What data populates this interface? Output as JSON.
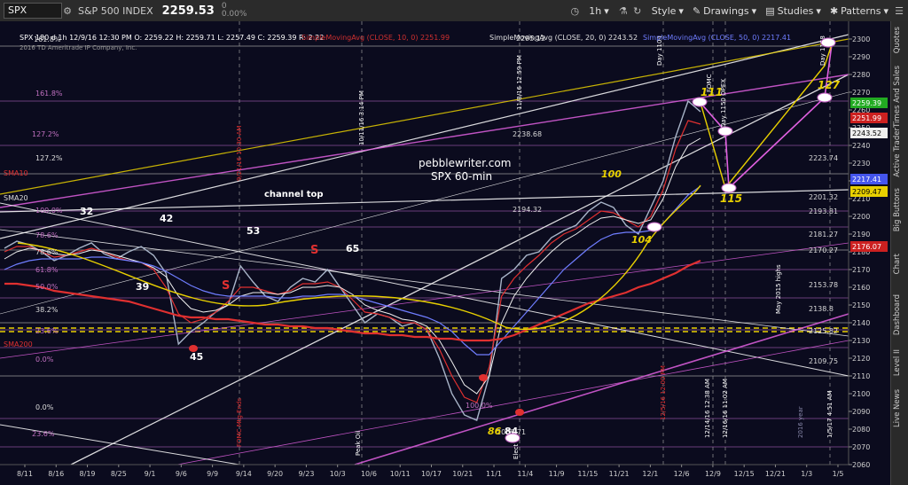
{
  "toolbar": {
    "symbol": "SPX",
    "name": "S&P 500 INDEX",
    "price": "2259.53",
    "change": "0",
    "change_pct": "0.00%",
    "interval": "1h",
    "style_label": "Style",
    "drawings_label": "Drawings",
    "studies_label": "Studies",
    "patterns_label": "Patterns"
  },
  "legend": {
    "ohlc": "SPX 180 d 1h   12/9/16 12:30 PM  O: 2259.22  H: 2259.71  L: 2257.49  C: 2259.39  R: 2.22",
    "sma10": "SimpleMovingAvg (CLOSE, 10, 0)  2251.99",
    "sma20": "SimpleMovingAvg (CLOSE, 20, 0)  2243.52",
    "sma50": "SimpleMovingAvg (CLOSE, 50, 0)  2217.41",
    "copyright": "2016 TD Ameritrade IP Company, Inc."
  },
  "right_tabs": [
    "Quotes",
    "Times And Sales",
    "Active Trader",
    "Big Buttons",
    "Chart",
    "Dashboard",
    "Level II",
    "Live News"
  ],
  "colors": {
    "background": "#0b0b1e",
    "sma10": "#e03030",
    "sma20": "#eeeeee",
    "sma50": "#6f7dff",
    "sma200": "#e03030",
    "gold": "#e8d000",
    "fib": "#c060c0",
    "channel": "#e060e0"
  },
  "chart_data": {
    "type": "line",
    "title": "pebblewriter.com SPX 60-min",
    "ylim": [
      2060,
      2305
    ],
    "y_ticks": [
      2060,
      2070,
      2080,
      2090,
      2100,
      2110,
      2120,
      2130,
      2140,
      2150,
      2160,
      2170,
      2180,
      2190,
      2200,
      2210,
      2220,
      2230,
      2240,
      2250,
      2260,
      2270,
      2280,
      2290,
      2300
    ],
    "x_labels": [
      "8/11",
      "8/16",
      "8/19",
      "8/25",
      "9/1",
      "9/6",
      "9/9",
      "9/14",
      "9/20",
      "9/23",
      "10/3",
      "10/6",
      "10/11",
      "10/17",
      "10/21",
      "11/1",
      "11/4",
      "11/9",
      "11/15",
      "11/21",
      "12/1",
      "12/6",
      "12/9",
      "12/15",
      "12/21",
      "1/3",
      "1/5"
    ],
    "series": [
      {
        "name": "SPX",
        "values": [
          2182,
          2186,
          2184,
          2180,
          2175,
          2178,
          2182,
          2185,
          2179,
          2176,
          2180,
          2183,
          2178,
          2168,
          2128,
          2135,
          2140,
          2146,
          2150,
          2172,
          2163,
          2155,
          2152,
          2160,
          2165,
          2163,
          2170,
          2160,
          2150,
          2140,
          2145,
          2143,
          2138,
          2140,
          2136,
          2120,
          2100,
          2088,
          2085,
          2110,
          2165,
          2170,
          2178,
          2180,
          2188,
          2192,
          2195,
          2203,
          2208,
          2205,
          2195,
          2190,
          2205,
          2220,
          2245,
          2265,
          2259
        ]
      },
      {
        "name": "SMA10",
        "values": [
          2180,
          2183,
          2183,
          2180,
          2177,
          2178,
          2180,
          2182,
          2180,
          2177,
          2175,
          2174,
          2170,
          2160,
          2145,
          2140,
          2142,
          2146,
          2152,
          2160,
          2160,
          2158,
          2156,
          2158,
          2162,
          2162,
          2163,
          2160,
          2153,
          2146,
          2145,
          2143,
          2140,
          2140,
          2136,
          2125,
          2110,
          2098,
          2095,
          2115,
          2155,
          2165,
          2172,
          2178,
          2185,
          2190,
          2193,
          2198,
          2203,
          2202,
          2198,
          2194,
          2200,
          2215,
          2238,
          2254,
          2252
        ]
      },
      {
        "name": "SMA20",
        "values": [
          2176,
          2180,
          2182,
          2181,
          2179,
          2178,
          2179,
          2181,
          2180,
          2178,
          2176,
          2174,
          2171,
          2166,
          2155,
          2148,
          2146,
          2147,
          2150,
          2155,
          2157,
          2157,
          2156,
          2157,
          2160,
          2160,
          2161,
          2160,
          2156,
          2150,
          2147,
          2145,
          2142,
          2141,
          2138,
          2130,
          2118,
          2105,
          2100,
          2110,
          2140,
          2155,
          2165,
          2173,
          2180,
          2186,
          2190,
          2195,
          2199,
          2200,
          2198,
          2196,
          2198,
          2210,
          2228,
          2240,
          2244
        ]
      },
      {
        "name": "SMA50",
        "values": [
          2170,
          2173,
          2175,
          2176,
          2176,
          2176,
          2176,
          2177,
          2177,
          2176,
          2175,
          2174,
          2172,
          2169,
          2165,
          2161,
          2158,
          2156,
          2155,
          2155,
          2155,
          2155,
          2154,
          2154,
          2155,
          2155,
          2156,
          2156,
          2155,
          2153,
          2151,
          2149,
          2147,
          2145,
          2143,
          2140,
          2135,
          2128,
          2122,
          2122,
          2130,
          2138,
          2146,
          2154,
          2162,
          2170,
          2176,
          2182,
          2187,
          2190,
          2191,
          2191,
          2192,
          2196,
          2204,
          2212,
          2217
        ]
      },
      {
        "name": "SMA200",
        "values": [
          2162,
          2162,
          2161,
          2160,
          2158,
          2157,
          2156,
          2155,
          2154,
          2153,
          2152,
          2150,
          2148,
          2146,
          2144,
          2143,
          2143,
          2142,
          2142,
          2141,
          2140,
          2139,
          2139,
          2138,
          2138,
          2137,
          2137,
          2136,
          2135,
          2134,
          2134,
          2133,
          2133,
          2132,
          2132,
          2131,
          2131,
          2130,
          2130,
          2130,
          2131,
          2133,
          2136,
          2139,
          2142,
          2145,
          2148,
          2151,
          2153,
          2155,
          2157,
          2160,
          2162,
          2165,
          2168,
          2172,
          2175
        ]
      }
    ],
    "price_labels": [
      {
        "value": "2259.39",
        "color": "#22aa22"
      },
      {
        "value": "2251.99",
        "color": "#cc2020"
      },
      {
        "value": "2243.52",
        "color": "#eeeeee"
      },
      {
        "value": "2217.41",
        "color": "#4455ee"
      },
      {
        "value": "2209.47",
        "color": "#e8d000"
      },
      {
        "value": "2176.07",
        "color": "#cc2020"
      }
    ],
    "level_labels": [
      "2295.12",
      "2238.68",
      "2223.74",
      "2201.32",
      "2194.32",
      "2193.81",
      "2181.27",
      "2170.27",
      "2153.78",
      "2138.8",
      "2125.82",
      "2109.75",
      "2069.71"
    ],
    "fib_labels": [
      "161.8%",
      "161.8%",
      "127.2%",
      "127.2%",
      "100.0%",
      "78.6%",
      "78.6%",
      "61.8%",
      "50.0%",
      "38.2%",
      "23.6%",
      "0.0%",
      "0.0%",
      "23.6%",
      "100.0%"
    ],
    "ma_labels": [
      "SMA10",
      "SMA20",
      "SMA200"
    ],
    "annotations": [
      "32",
      "42",
      "53",
      "65",
      "39",
      "45",
      "86",
      "84",
      "100",
      "104",
      "111",
      "115",
      "127",
      "S",
      "S",
      "channel top"
    ],
    "event_labels": [
      "9/21/16 10:30 AM",
      "10/11/16 3:14 PM",
      "11/8/16 12:59 PM",
      "12/5/16 12:00 PM",
      "12/14/16 12:38 AM",
      "12/16/16 11:02 AM",
      "1/5/17 4:51 AM",
      "Day 1104",
      "Day 1158",
      "Day 1150 OPEX",
      "FOMC",
      "FOMC Mtg Ends",
      "Peak Oil",
      "Elect",
      "May 2015 highs",
      "2016 year"
    ]
  }
}
